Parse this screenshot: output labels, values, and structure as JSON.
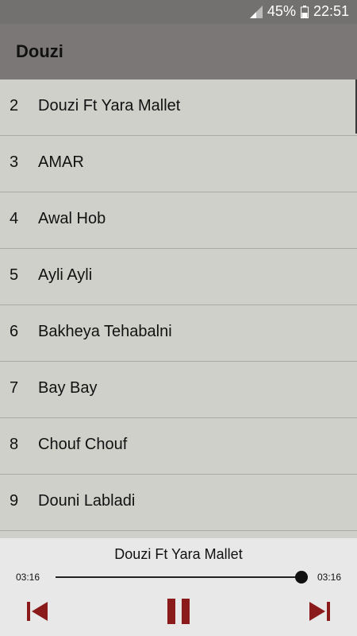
{
  "status": {
    "battery": "45%",
    "time": "22:51"
  },
  "app": {
    "title": "Douzi"
  },
  "tracks": [
    {
      "num": "2",
      "name": "Douzi Ft Yara Mallet"
    },
    {
      "num": "3",
      "name": "AMAR"
    },
    {
      "num": "4",
      "name": "Awal Hob"
    },
    {
      "num": "5",
      "name": "Ayli Ayli"
    },
    {
      "num": "6",
      "name": "Bakheya Tehabalni"
    },
    {
      "num": "7",
      "name": "Bay Bay"
    },
    {
      "num": "8",
      "name": "Chouf Chouf"
    },
    {
      "num": "9",
      "name": "Douni Labladi"
    }
  ],
  "player": {
    "now_playing": "Douzi Ft Yara Mallet",
    "elapsed": "03:16",
    "duration": "03:16",
    "progress_fraction": 1.0
  },
  "colors": {
    "accent": "#8b1a1a"
  }
}
